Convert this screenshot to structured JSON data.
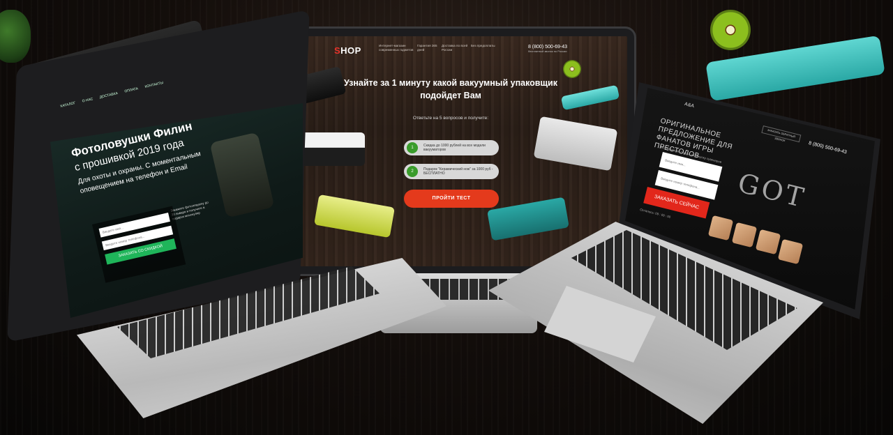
{
  "center": {
    "logo_prefix": "S",
    "logo_rest": "HOP",
    "nav": [
      "Интернет-магазин современных гаджетов",
      "Гарантия 365 дней",
      "Доставка по всей России",
      "Без предоплаты"
    ],
    "phone": "8 (800) 500-69-43",
    "phone_note": "бесплатный звонок по России",
    "title": "Узнайте за 1 минуту какой вакуумный упаковщик подойдет Вам",
    "subtitle": "Ответьте на 5 вопросов и получите:",
    "bonuses": [
      {
        "num": "1",
        "text": "Скидка до 1000 рублей на все модели вакууматоров"
      },
      {
        "num": "2",
        "text": "Подарок \"Керамический нож\" за 1000 руб - БЕСПЛАТНО"
      }
    ],
    "cta": "ПРОЙТИ ТЕСТ"
  },
  "left": {
    "nav": [
      "КАТАЛОГ",
      "О НАС",
      "ДОСТАВКА",
      "ОПЛАТА",
      "КОНТАКТЫ"
    ],
    "title": "Фотоловушки Филин",
    "title2": "с прошивкой 2019 года",
    "subtitle": "Для охоты и охраны. С моментальным оповещением на телефон и Email",
    "inputs": [
      "Введите имя...",
      "Введите номер телефона..."
    ],
    "button": "ЗАКАЗАТЬ СО СКИДКОЙ",
    "note": "Закажите фотоловушку до 30 января и получите в подарок монокуляр"
  },
  "right": {
    "brand": "A&A",
    "callback": "ЗАКАЗАТЬ ОБРАТНЫЙ ЗВОНОК",
    "phone": "8 (800) 500-69-43",
    "title": "Оригинальное предложение для фанатов игры престолов",
    "subtitle": "Эксклюзивная скидка на покупку сувениров",
    "inputs": [
      "Введите имя...",
      "Введите номер телефона..."
    ],
    "button": "ЗАКАЗАТЬ СЕЙЧАС",
    "timer_label": "Осталось:",
    "timer_values": [
      "09",
      "09",
      "00"
    ],
    "show_logo": "GOT"
  },
  "colors": {
    "accent_red": "#e43a1c",
    "accent_green": "#1fb55a",
    "badge_green": "#3a9c2b"
  }
}
